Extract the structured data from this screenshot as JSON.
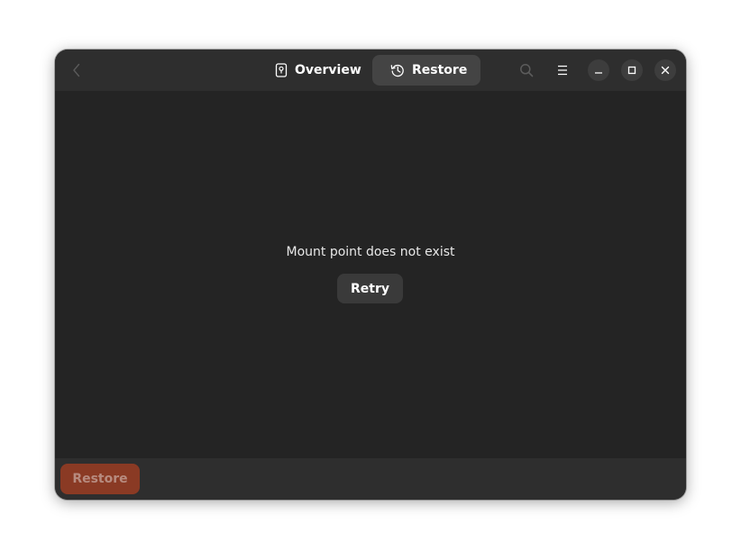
{
  "header": {
    "tabs": [
      {
        "label": "Overview",
        "icon": "drive-icon",
        "active": false
      },
      {
        "label": "Restore",
        "icon": "history-icon",
        "active": true
      }
    ]
  },
  "main": {
    "status_message": "Mount point does not exist",
    "retry_label": "Retry"
  },
  "footer": {
    "restore_label": "Restore"
  },
  "colors": {
    "window_bg": "#242424",
    "headerbar_bg": "#2e2e2e",
    "active_tab_bg": "#444444",
    "destructive_button": "#8a3a24"
  }
}
